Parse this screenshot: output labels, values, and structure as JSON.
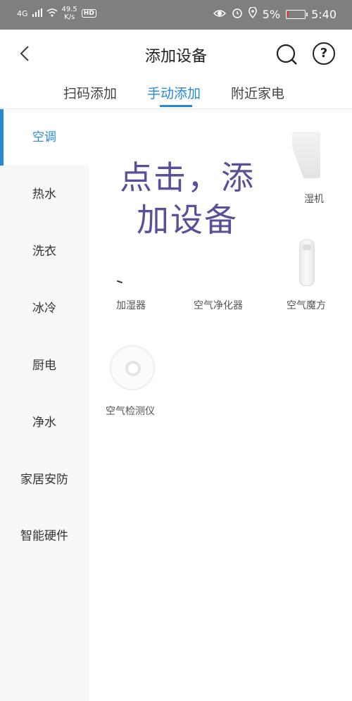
{
  "status_bar": {
    "network": "4G",
    "speed_value": "49.5",
    "speed_unit": "K/s",
    "hd": "HD",
    "battery": "5%",
    "time": "5:40",
    "battery_level": 0.05
  },
  "header": {
    "title": "添加设备"
  },
  "tabs": [
    {
      "label": "扫码添加",
      "active": false
    },
    {
      "label": "手动添加",
      "active": true
    },
    {
      "label": "附近家电",
      "active": false
    }
  ],
  "sidebar": {
    "items": [
      {
        "label": "空调",
        "active": true
      },
      {
        "label": "热水"
      },
      {
        "label": "洗衣"
      },
      {
        "label": "冰冷"
      },
      {
        "label": "厨电"
      },
      {
        "label": "净水"
      },
      {
        "label": "家居安防"
      },
      {
        "label": "智能硬件"
      }
    ]
  },
  "overlay": {
    "line1": "点击，添",
    "line2": "加设备"
  },
  "devices": [
    {
      "label": "湿机"
    },
    {
      "label": "加湿器"
    },
    {
      "label": "空气净化器"
    },
    {
      "label": "空气魔方"
    },
    {
      "label": "空气检测仪"
    }
  ],
  "colors": {
    "accent": "#2788d6",
    "overlay_text": "#5a4f9a",
    "status_bar": "#7f7f7f"
  }
}
